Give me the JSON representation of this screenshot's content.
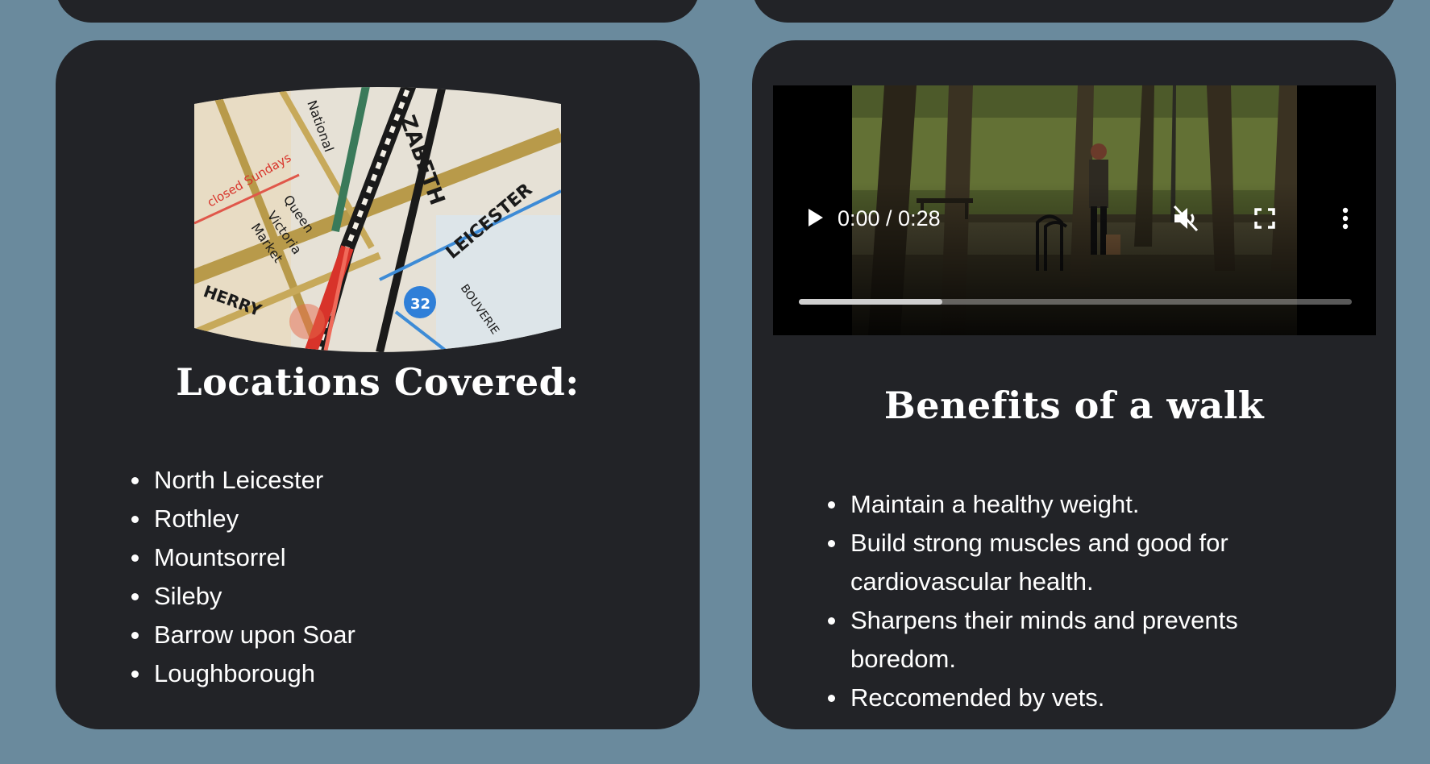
{
  "locations": {
    "heading": "Locations Covered:",
    "image_alt": "Map of Leicester",
    "items": [
      "North Leicester",
      "Rothley",
      "Mountsorrel",
      "Sileby",
      "Barrow upon Soar",
      "Loughborough"
    ]
  },
  "video": {
    "time_display": "0:00 / 0:28",
    "muted": true,
    "loaded_fraction": 0.26,
    "icons": {
      "play": "play-icon",
      "mute": "muted-speaker-icon",
      "fullscreen": "fullscreen-icon",
      "more": "more-vertical-icon"
    }
  },
  "benefits": {
    "heading": "Benefits of a walk",
    "items": [
      "Maintain a healthy weight.",
      "Build strong muscles and good for cardiovascular health.",
      "Sharpens their minds and prevents boredom.",
      "Reccomended by vets."
    ]
  },
  "colors": {
    "page_background": "#6a8a9d",
    "card_background": "#222327",
    "text": "#ffffff"
  }
}
